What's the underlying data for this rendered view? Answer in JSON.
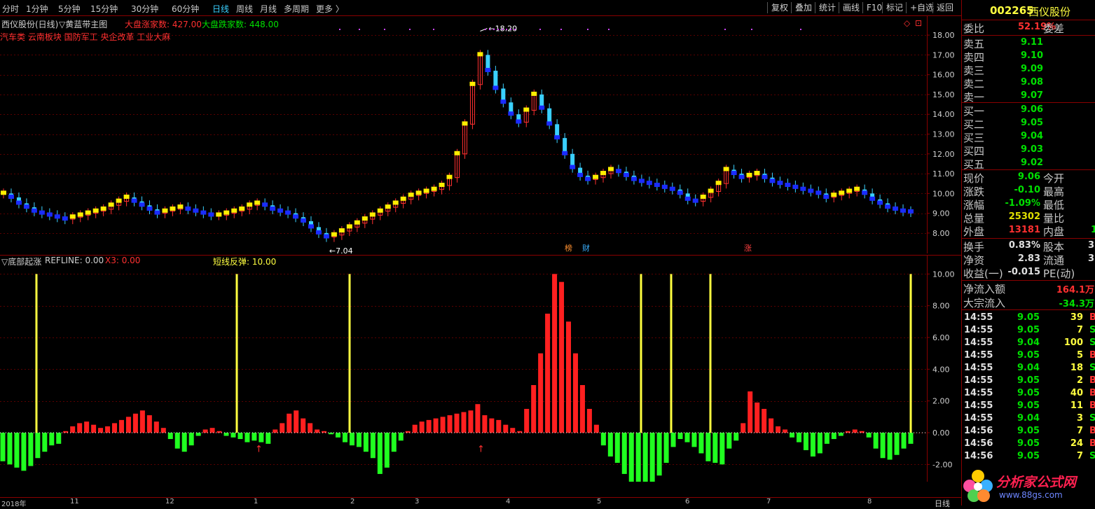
{
  "menu": {
    "periods": [
      "分时",
      "1分钟",
      "5分钟",
      "15分钟",
      "30分钟",
      "60分钟",
      "日线",
      "周线",
      "月线",
      "多周期",
      "更多"
    ],
    "active": "日线",
    "tools": [
      "复权",
      "叠加",
      "统计",
      "画线",
      "F10",
      "标记",
      "+自选",
      "返回"
    ]
  },
  "main_chart": {
    "header_name": "西仪股份(日线)",
    "header_indicator": "黄蓝带主图",
    "up_count_label": "大盘涨家数: 427.00",
    "down_count_label": "大盘跌家数: 448.00",
    "sectors": "汽车类 云南板块 国防军工 央企改革 工业大麻",
    "high_label": "18.20",
    "low_label": "7.04",
    "event_tags": [
      "榜",
      "财",
      "涨"
    ],
    "y_axis": [
      "18.00",
      "17.00",
      "16.00",
      "15.00",
      "14.00",
      "13.00",
      "12.00",
      "11.00",
      "10.00",
      "9.00",
      "8.00"
    ]
  },
  "indicator": {
    "header_name": "底部起涨",
    "refline": "REFLINE: 0.00",
    "x3": "X3: 0.00",
    "rebound": "短线反弹: 10.00",
    "y_axis": [
      "10.00",
      "8.00",
      "6.00",
      "4.00",
      "2.00",
      "0.00",
      "-2.00"
    ]
  },
  "bottom_axis": [
    "2018年",
    "11",
    "12",
    "1",
    "2",
    "3",
    "4",
    "5",
    "6",
    "7",
    "8"
  ],
  "bottom_right_label": "日线",
  "quote": {
    "code": "002265",
    "name": "西仪股份",
    "weibi_label": "委比",
    "weibi_value": "52.19%",
    "weicha_label": "委差",
    "asks": [
      {
        "label": "卖五",
        "price": "9.11"
      },
      {
        "label": "卖四",
        "price": "9.10"
      },
      {
        "label": "卖三",
        "price": "9.09"
      },
      {
        "label": "卖二",
        "price": "9.08"
      },
      {
        "label": "卖一",
        "price": "9.07"
      }
    ],
    "bids": [
      {
        "label": "买一",
        "price": "9.06"
      },
      {
        "label": "买二",
        "price": "9.05"
      },
      {
        "label": "买三",
        "price": "9.04"
      },
      {
        "label": "买四",
        "price": "9.03"
      },
      {
        "label": "买五",
        "price": "9.02"
      }
    ],
    "stats": [
      {
        "label": "现价",
        "value": "9.06",
        "label2": "今开",
        "color": "#00e000"
      },
      {
        "label": "涨跌",
        "value": "-0.10",
        "label2": "最高",
        "color": "#00e000"
      },
      {
        "label": "涨幅",
        "value": "-1.09%",
        "label2": "最低",
        "color": "#00e000"
      },
      {
        "label": "总量",
        "value": "25302",
        "label2": "量比",
        "color": "#e0e000"
      },
      {
        "label": "外盘",
        "value": "13181",
        "label2": "内盘",
        "color": "#ff3030",
        "extra": "1"
      }
    ],
    "stats2": [
      {
        "label": "换手",
        "value": "0.83%",
        "label2": "股本",
        "extra": "3."
      },
      {
        "label": "净资",
        "value": "2.83",
        "label2": "流通",
        "extra": "3."
      },
      {
        "label": "收益(一)",
        "value": "-0.015",
        "label2": "PE(动)",
        "extra": ""
      }
    ],
    "flows": [
      {
        "label": "净流入额",
        "value": "164.1万",
        "color": "#ff3030"
      },
      {
        "label": "大宗流入",
        "value": "-34.3万",
        "color": "#00e000"
      }
    ],
    "trades": [
      {
        "time": "14:55",
        "price": "9.05",
        "vol": "39",
        "side": "B"
      },
      {
        "time": "14:55",
        "price": "9.05",
        "vol": "7",
        "side": "S"
      },
      {
        "time": "14:55",
        "price": "9.04",
        "vol": "100",
        "side": "S"
      },
      {
        "time": "14:55",
        "price": "9.05",
        "vol": "5",
        "side": "B"
      },
      {
        "time": "14:55",
        "price": "9.04",
        "vol": "18",
        "side": "S"
      },
      {
        "time": "14:55",
        "price": "9.05",
        "vol": "2",
        "side": "B"
      },
      {
        "time": "14:55",
        "price": "9.05",
        "vol": "40",
        "side": "B"
      },
      {
        "time": "14:55",
        "price": "9.05",
        "vol": "11",
        "side": "B"
      },
      {
        "time": "14:55",
        "price": "9.04",
        "vol": "3",
        "side": "S"
      },
      {
        "time": "14:56",
        "price": "9.05",
        "vol": "7",
        "side": "B"
      },
      {
        "time": "14:56",
        "price": "9.05",
        "vol": "24",
        "side": "B"
      },
      {
        "time": "14:56",
        "price": "9.05",
        "vol": "7",
        "side": "S"
      }
    ]
  },
  "watermark": {
    "text": "分析家公式网",
    "url": "www.88gs.com"
  },
  "chart_data": [
    {
      "type": "candlestick",
      "title": "西仪股份(日线)",
      "ylim": [
        7.5,
        18.5
      ],
      "close": [
        10.0,
        9.8,
        9.5,
        9.3,
        9.1,
        9.0,
        8.9,
        8.8,
        8.7,
        8.8,
        8.9,
        9.0,
        9.1,
        9.2,
        9.4,
        9.6,
        9.8,
        9.6,
        9.4,
        9.2,
        9.0,
        9.1,
        9.2,
        9.3,
        9.2,
        9.1,
        9.0,
        8.9,
        8.9,
        9.0,
        9.1,
        9.2,
        9.4,
        9.5,
        9.4,
        9.2,
        9.1,
        9.0,
        8.8,
        8.6,
        8.3,
        8.0,
        7.8,
        7.9,
        8.1,
        8.3,
        8.5,
        8.7,
        8.9,
        9.1,
        9.3,
        9.5,
        9.7,
        9.9,
        10.0,
        10.1,
        10.2,
        10.4,
        10.8,
        12.0,
        13.5,
        15.5,
        17.0,
        16.2,
        15.3,
        14.6,
        14.0,
        13.6,
        14.2,
        15.0,
        14.3,
        13.5,
        12.8,
        12.0,
        11.3,
        10.9,
        10.7,
        10.8,
        11.0,
        11.2,
        11.1,
        10.9,
        10.7,
        10.6,
        10.5,
        10.4,
        10.3,
        10.2,
        10.0,
        9.7,
        9.6,
        9.8,
        10.1,
        10.5,
        11.2,
        11.0,
        10.8,
        10.9,
        11.0,
        10.8,
        10.6,
        10.5,
        10.4,
        10.3,
        10.2,
        10.1,
        10.0,
        9.8,
        9.9,
        10.0,
        10.1,
        10.2,
        10.0,
        9.7,
        9.5,
        9.3,
        9.2,
        9.1,
        9.06
      ],
      "annotations": {
        "high": "18.20",
        "low": "7.04"
      }
    },
    {
      "type": "bar",
      "title": "底部起涨",
      "ylim": [
        -3.0,
        10.5
      ],
      "values": [
        -1.8,
        -2.0,
        -2.2,
        -2.4,
        -2.1,
        -1.6,
        -1.2,
        -0.8,
        -0.7,
        0.1,
        0.4,
        0.6,
        0.7,
        0.5,
        0.3,
        0.4,
        0.6,
        0.8,
        1.0,
        1.2,
        1.4,
        1.1,
        0.7,
        0.3,
        -0.4,
        -1.0,
        -1.2,
        -0.8,
        -0.2,
        0.2,
        0.3,
        0.1,
        -0.2,
        -0.3,
        -0.4,
        -0.6,
        -0.5,
        -0.6,
        -0.7,
        0.2,
        0.6,
        1.2,
        1.4,
        0.9,
        0.6,
        0.2,
        0.1,
        -0.1,
        -0.3,
        -0.6,
        -0.8,
        -0.9,
        -1.2,
        -1.6,
        -2.6,
        -2.2,
        -1.2,
        -0.5,
        0.1,
        0.5,
        0.7,
        0.8,
        0.9,
        1.0,
        1.1,
        1.2,
        1.3,
        1.4,
        1.8,
        1.1,
        0.9,
        0.8,
        0.5,
        0.3,
        0.1,
        1.5,
        3.0,
        5.0,
        7.5,
        10.0,
        9.5,
        7.0,
        5.0,
        3.0,
        1.5,
        0.5,
        -0.8,
        -1.5,
        -1.9,
        -2.6,
        -3.2,
        -3.6,
        -4.0,
        -3.3,
        -2.7,
        -1.9,
        -0.9,
        -0.4,
        -0.6,
        -0.9,
        -1.3,
        -1.8,
        -1.9,
        -2.0,
        -1.0,
        -0.5,
        0.6,
        2.6,
        1.9,
        1.5,
        0.9,
        0.4,
        0.2,
        -0.3,
        -0.6,
        -1.1,
        -1.5,
        -1.3,
        -0.7,
        -0.4,
        -0.2,
        0.1,
        0.2,
        0.1,
        -0.3,
        -1.0,
        -1.6,
        -1.7,
        -1.4,
        -1.0,
        -0.7
      ]
    }
  ]
}
